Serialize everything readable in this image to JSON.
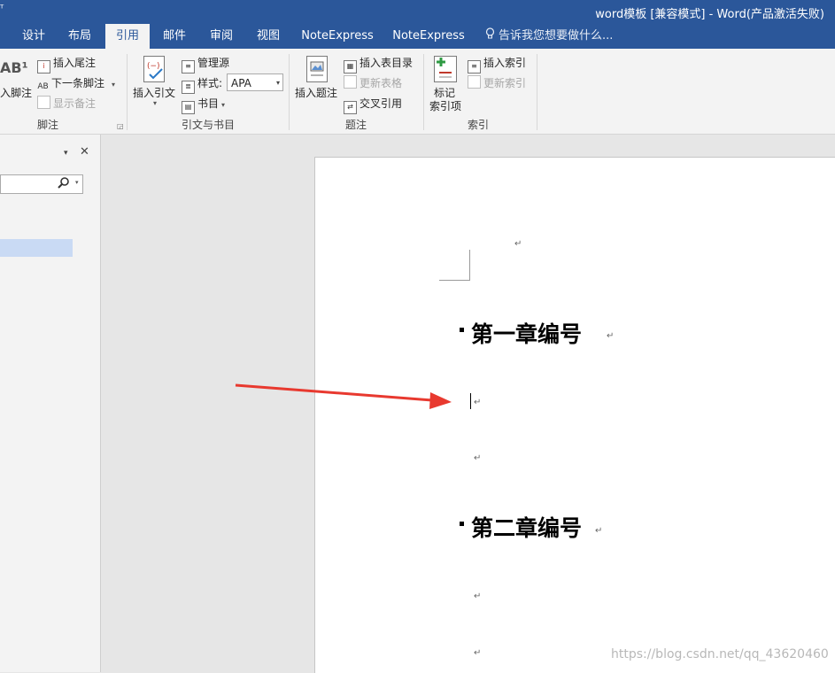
{
  "title_bar": {
    "title": "word模板 [兼容模式] - Word(产品激活失败)",
    "qat_glyph": "ᵀ"
  },
  "tabs": [
    {
      "label": "设计"
    },
    {
      "label": "布局"
    },
    {
      "label": "引用",
      "active": true
    },
    {
      "label": "邮件"
    },
    {
      "label": "审阅"
    },
    {
      "label": "视图"
    },
    {
      "label": "NoteExpress"
    },
    {
      "label": "NoteExpress"
    }
  ],
  "tell_me": {
    "placeholder": "告诉我您想要做什么..."
  },
  "ribbon": {
    "footnotes": {
      "insert_footnote_big_icon": "AB¹",
      "insert_footnote": "入脚注",
      "insert_endnote": "插入尾注",
      "next_footnote": "下一条脚注",
      "show_notes": "显示备注",
      "group_label": "脚注"
    },
    "citations": {
      "insert_citation": "插入引文",
      "manage_sources": "管理源",
      "style_label": "样式:",
      "style_value": "APA",
      "bibliography": "书目",
      "group_label": "引文与书目"
    },
    "captions": {
      "insert_caption": "插入题注",
      "insert_table_of_figures": "插入表目录",
      "update_table": "更新表格",
      "cross_reference": "交叉引用",
      "group_label": "题注"
    },
    "index": {
      "mark_entry_line1": "标记",
      "mark_entry_line2": "索引项",
      "insert_index": "插入索引",
      "update_index": "更新索引",
      "group_label": "索引"
    }
  },
  "nav_pane": {
    "search_placeholder": "",
    "close_glyph": "✕",
    "dropdown_glyph": "▾"
  },
  "document": {
    "heading1": "第一章编号",
    "heading2": "第二章编号",
    "paragraph_mark": "↵"
  },
  "watermark": "https://blog.csdn.net/qq_43620460",
  "colors": {
    "brand": "#2b579a",
    "arrow": "#e8392f",
    "selection": "#c9daf4"
  }
}
